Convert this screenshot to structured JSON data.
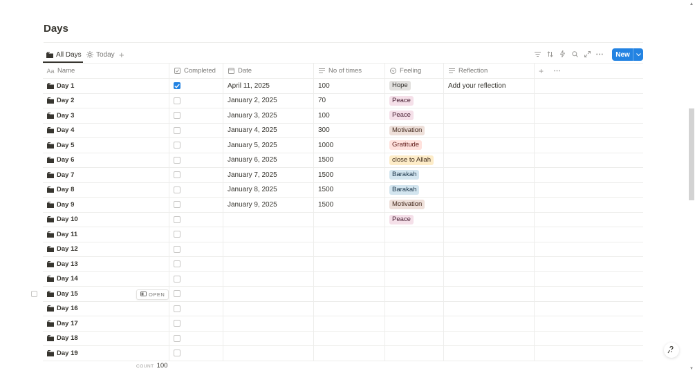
{
  "page": {
    "title": "Days"
  },
  "views": {
    "tabs": [
      {
        "label": "All Days",
        "icon": "page-stack-icon",
        "active": true
      },
      {
        "label": "Today",
        "icon": "sun-icon",
        "active": false
      }
    ],
    "add_label": "+"
  },
  "toolbar": {
    "tools": [
      "filter-icon",
      "sort-icon",
      "lightning-icon",
      "search-icon",
      "expand-icon",
      "more-icon"
    ],
    "new_label": "New"
  },
  "columns": {
    "name": "Name",
    "name_icon": "Aa",
    "completed": "Completed",
    "date": "Date",
    "times": "No of times",
    "feeling": "Feeling",
    "reflection": "Reflection"
  },
  "rows": [
    {
      "name": "Day 1",
      "completed": true,
      "date": "April 11, 2025",
      "times": "100",
      "feeling": "Hope",
      "reflection": "Add your reflection"
    },
    {
      "name": "Day 2",
      "completed": false,
      "date": "January 2, 2025",
      "times": "70",
      "feeling": "Peace",
      "reflection": ""
    },
    {
      "name": "Day 3",
      "completed": false,
      "date": "January 3, 2025",
      "times": "100",
      "feeling": "Peace",
      "reflection": ""
    },
    {
      "name": "Day 4",
      "completed": false,
      "date": "January 4, 2025",
      "times": "300",
      "feeling": "Motivation",
      "reflection": ""
    },
    {
      "name": "Day 5",
      "completed": false,
      "date": "January 5, 2025",
      "times": "1000",
      "feeling": "Gratitude",
      "reflection": ""
    },
    {
      "name": "Day 6",
      "completed": false,
      "date": "January 6, 2025",
      "times": "1500",
      "feeling": "close to Allah",
      "reflection": ""
    },
    {
      "name": "Day 7",
      "completed": false,
      "date": "January 7, 2025",
      "times": "1500",
      "feeling": "Barakah",
      "reflection": ""
    },
    {
      "name": "Day 8",
      "completed": false,
      "date": "January 8, 2025",
      "times": "1500",
      "feeling": "Barakah",
      "reflection": ""
    },
    {
      "name": "Day 9",
      "completed": false,
      "date": "January 9, 2025",
      "times": "1500",
      "feeling": "Motivation",
      "reflection": ""
    },
    {
      "name": "Day 10",
      "completed": false,
      "date": "",
      "times": "",
      "feeling": "Peace",
      "reflection": ""
    },
    {
      "name": "Day 11",
      "completed": false,
      "date": "",
      "times": "",
      "feeling": "",
      "reflection": ""
    },
    {
      "name": "Day 12",
      "completed": false,
      "date": "",
      "times": "",
      "feeling": "",
      "reflection": ""
    },
    {
      "name": "Day 13",
      "completed": false,
      "date": "",
      "times": "",
      "feeling": "",
      "reflection": ""
    },
    {
      "name": "Day 14",
      "completed": false,
      "date": "",
      "times": "",
      "feeling": "",
      "reflection": ""
    },
    {
      "name": "Day 15",
      "completed": false,
      "date": "",
      "times": "",
      "feeling": "",
      "reflection": "",
      "hovered": true
    },
    {
      "name": "Day 16",
      "completed": false,
      "date": "",
      "times": "",
      "feeling": "",
      "reflection": ""
    },
    {
      "name": "Day 17",
      "completed": false,
      "date": "",
      "times": "",
      "feeling": "",
      "reflection": ""
    },
    {
      "name": "Day 18",
      "completed": false,
      "date": "",
      "times": "",
      "feeling": "",
      "reflection": ""
    },
    {
      "name": "Day 19",
      "completed": false,
      "date": "",
      "times": "",
      "feeling": "",
      "reflection": ""
    }
  ],
  "row_actions": {
    "open_label": "OPEN"
  },
  "tag_colors": {
    "Hope": {
      "bg": "#e3e2e0",
      "fg": "#32302c"
    },
    "Peace": {
      "bg": "#f5e0e9",
      "fg": "#4c2337"
    },
    "Motivation": {
      "bg": "#eee0da",
      "fg": "#44291d"
    },
    "Gratitude": {
      "bg": "#ffe2dd",
      "fg": "#5d1715"
    },
    "close to Allah": {
      "bg": "#fdecc8",
      "fg": "#402c1b"
    },
    "Barakah": {
      "bg": "#d3e5ef",
      "fg": "#183347"
    }
  },
  "footer": {
    "count_label": "COUNT",
    "count_value": "100"
  },
  "colors": {
    "accent": "#2383e2",
    "text": "#37352f",
    "muted": "#787774",
    "border": "#ededeb"
  }
}
